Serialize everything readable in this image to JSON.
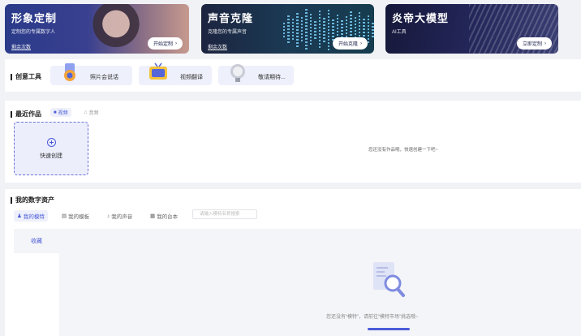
{
  "banners": [
    {
      "title": "形象定制",
      "subtitle": "定制您的专属数字人",
      "sub2": "剩余次数",
      "button": "开始定制"
    },
    {
      "title": "声音克隆",
      "subtitle": "克隆您的专属声音",
      "sub2": "剩余次数",
      "button": "开始克隆"
    },
    {
      "title": "炎帝大模型",
      "subtitle": "AI工具",
      "sub2": "",
      "button": "立即定制"
    }
  ],
  "tools": {
    "title": "创意工具",
    "items": [
      {
        "label": "照片会说话",
        "icon": "talking-photo-icon"
      },
      {
        "label": "视频翻译",
        "icon": "video-translate-icon"
      },
      {
        "label": "敬请期待...",
        "icon": "coming-soon-icon"
      }
    ]
  },
  "works": {
    "title": "最近作品",
    "tabs": [
      {
        "label": "视频",
        "icon": "video-icon",
        "active": true
      },
      {
        "label": "音频",
        "icon": "audio-icon",
        "active": false
      }
    ],
    "quick_create": "快速创建",
    "empty_text": "您还没有作品哦，快速创建一下吧~"
  },
  "assets": {
    "title": "我的数字资产",
    "tabs": [
      {
        "label": "我的模特",
        "icon": "user-icon",
        "active": true
      },
      {
        "label": "我的模板",
        "icon": "template-icon",
        "active": false
      },
      {
        "label": "我的声音",
        "icon": "mic-icon",
        "active": false
      },
      {
        "label": "我的台本",
        "icon": "script-icon",
        "active": false
      }
    ],
    "search_placeholder": "请输入模特名称搜索",
    "favorite": "收藏",
    "empty_text": "您还没有“模特”，请前往“模特市场”挑选哦~"
  },
  "colors": {
    "accent": "#4a5bd8",
    "background": "#f1f2f6"
  }
}
